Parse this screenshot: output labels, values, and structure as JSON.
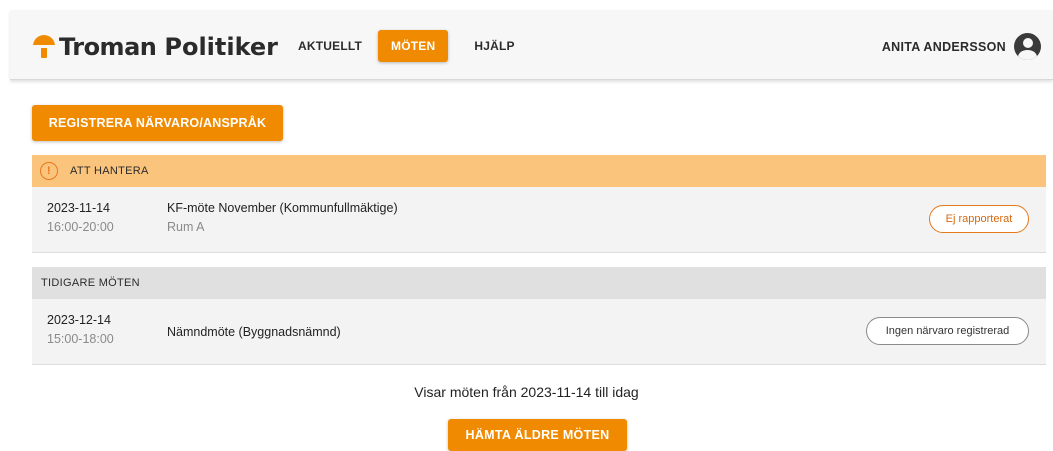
{
  "app": {
    "logo_brand": "Troman",
    "logo_product": "Politiker",
    "accent_color": "#f08a00"
  },
  "nav": {
    "items": [
      {
        "label": "AKTUELLT",
        "active": false
      },
      {
        "label": "MÖTEN",
        "active": true
      },
      {
        "label": "HJÄLP",
        "active": false
      }
    ]
  },
  "user": {
    "name": "ANITA ANDERSSON",
    "icon": "account-circle-icon"
  },
  "actions": {
    "register_label": "REGISTRERA NÄRVARO/ANSPRÅK",
    "fetch_older_label": "HÄMTA ÄLDRE MÖTEN"
  },
  "sections": {
    "attention": {
      "title": "ATT HANTERA",
      "icon": "warning-circle-icon",
      "color": "#fbc47d",
      "meetings": [
        {
          "date": "2023-11-14",
          "time": "16:00-20:00",
          "title": "KF-möte November (Kommunfullmäktige)",
          "room": "Rum A",
          "status": "Ej rapporterat"
        }
      ]
    },
    "previous": {
      "title": "TIDIGARE MÖTEN",
      "meetings": [
        {
          "date": "2023-12-14",
          "time": "15:00-18:00",
          "title": "Nämndmöte (Byggnadsnämnd)",
          "status": "Ingen närvaro registrerad"
        }
      ]
    }
  },
  "info": {
    "range_text": "Visar möten från 2023-11-14 till idag"
  }
}
